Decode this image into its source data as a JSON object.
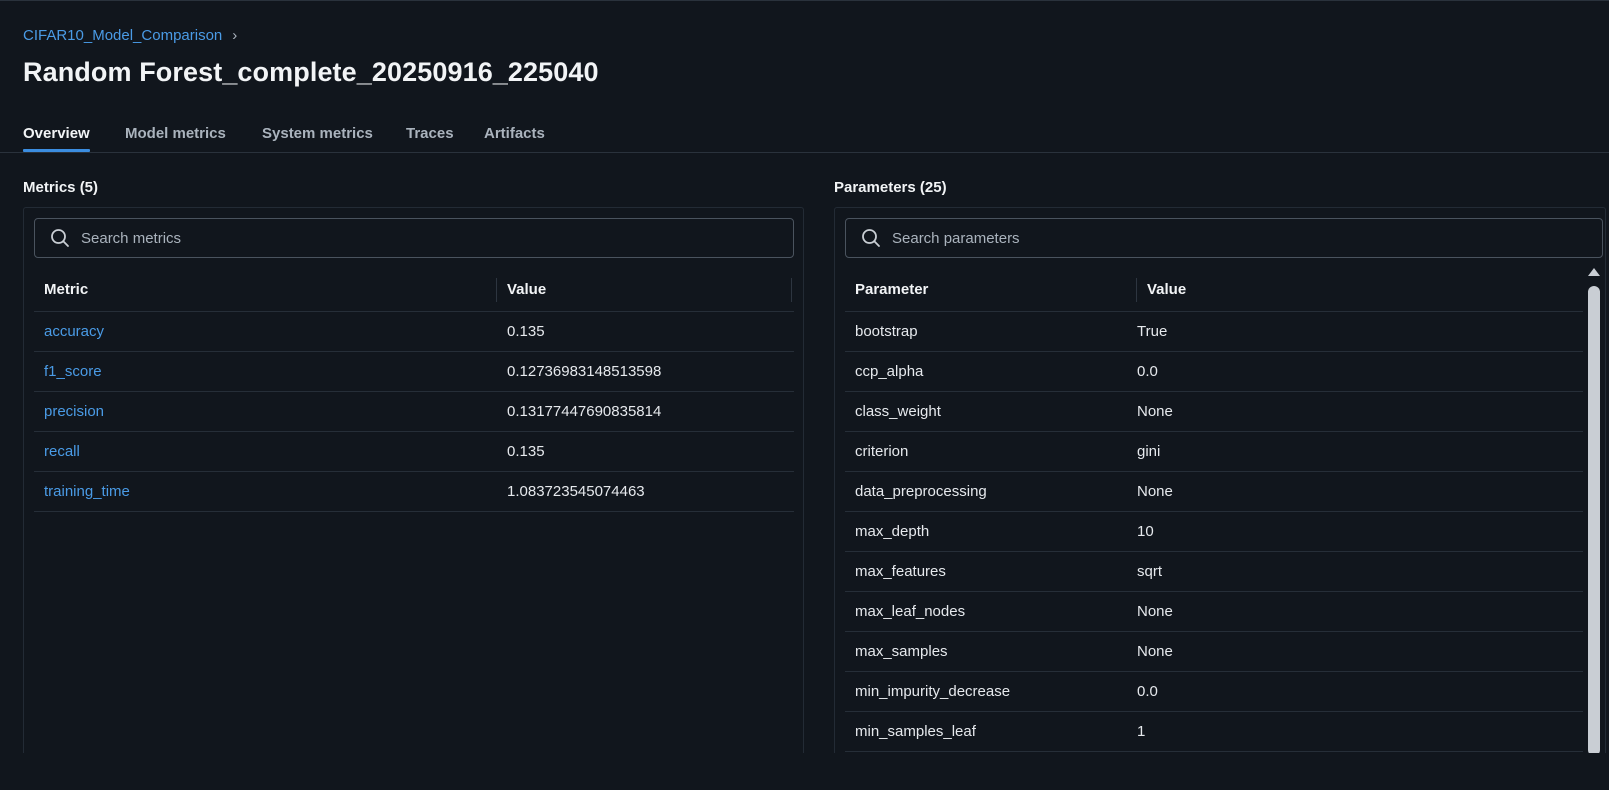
{
  "breadcrumb": {
    "parent": "CIFAR10_Model_Comparison",
    "chevron": "›"
  },
  "title": "Random Forest_complete_20250916_225040",
  "tabs": [
    "Overview",
    "Model metrics",
    "System metrics",
    "Traces",
    "Artifacts"
  ],
  "active_tab": "Overview",
  "metrics": {
    "heading": "Metrics (5)",
    "search_placeholder": "Search metrics",
    "col_metric": "Metric",
    "col_value": "Value",
    "rows": [
      {
        "name": "accuracy",
        "value": "0.135"
      },
      {
        "name": "f1_score",
        "value": "0.12736983148513598"
      },
      {
        "name": "precision",
        "value": "0.13177447690835814"
      },
      {
        "name": "recall",
        "value": "0.135"
      },
      {
        "name": "training_time",
        "value": "1.083723545074463"
      }
    ]
  },
  "parameters": {
    "heading": "Parameters (25)",
    "search_placeholder": "Search parameters",
    "col_parameter": "Parameter",
    "col_value": "Value",
    "rows": [
      {
        "name": "bootstrap",
        "value": "True"
      },
      {
        "name": "ccp_alpha",
        "value": "0.0"
      },
      {
        "name": "class_weight",
        "value": "None"
      },
      {
        "name": "criterion",
        "value": "gini"
      },
      {
        "name": "data_preprocessing",
        "value": "None"
      },
      {
        "name": "max_depth",
        "value": "10"
      },
      {
        "name": "max_features",
        "value": "sqrt"
      },
      {
        "name": "max_leaf_nodes",
        "value": "None"
      },
      {
        "name": "max_samples",
        "value": "None"
      },
      {
        "name": "min_impurity_decrease",
        "value": "0.0"
      },
      {
        "name": "min_samples_leaf",
        "value": "1"
      }
    ]
  },
  "colors": {
    "background": "#11161d",
    "link": "#4a9be6",
    "accent": "#3b8de0"
  }
}
